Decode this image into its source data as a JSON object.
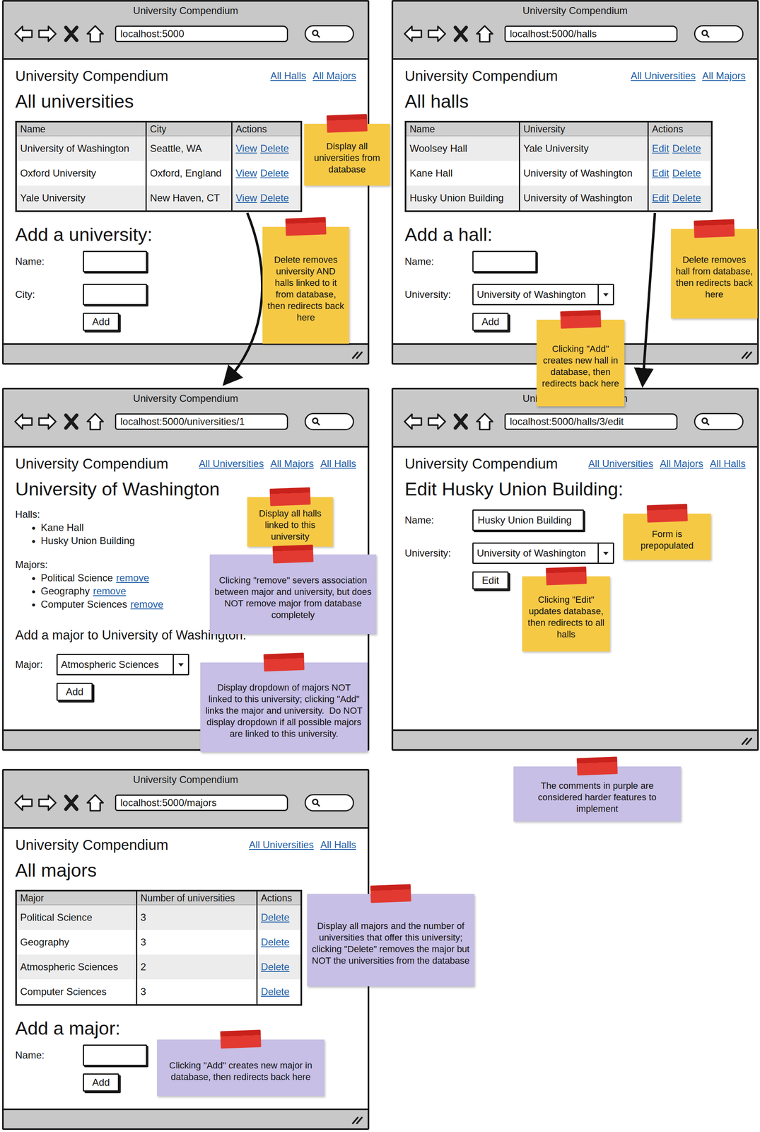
{
  "windows": [
    {
      "kind": "list",
      "title": "University Compendium",
      "url": "localhost:5000",
      "brand": "University Compendium",
      "nav": [
        "All Halls",
        "All Majors"
      ],
      "heading": "All universities",
      "table": {
        "columns": [
          "Name",
          "City",
          "Actions"
        ],
        "rows": [
          {
            "cells": [
              "University of Washington",
              "Seattle, WA"
            ],
            "actions": [
              "View",
              "Delete"
            ]
          },
          {
            "cells": [
              "Oxford University",
              "Oxford, England"
            ],
            "actions": [
              "View",
              "Delete"
            ]
          },
          {
            "cells": [
              "Yale University",
              "New Haven, CT"
            ],
            "actions": [
              "View",
              "Delete"
            ]
          }
        ]
      },
      "form": {
        "title": "Add a university:",
        "fields": [
          {
            "label": "Name:",
            "kind": "text",
            "value": ""
          },
          {
            "label": "City:",
            "kind": "text",
            "value": ""
          }
        ],
        "button": "Add"
      }
    },
    {
      "kind": "list",
      "title": "University Compendium",
      "url": "localhost:5000/halls",
      "brand": "University Compendium",
      "nav": [
        "All Universities",
        "All Majors"
      ],
      "heading": "All halls",
      "table": {
        "columns": [
          "Name",
          "University",
          "Actions"
        ],
        "rows": [
          {
            "cells": [
              "Woolsey Hall",
              "Yale University"
            ],
            "actions": [
              "Edit",
              "Delete"
            ]
          },
          {
            "cells": [
              "Kane Hall",
              "University of Washington"
            ],
            "actions": [
              "Edit",
              "Delete"
            ]
          },
          {
            "cells": [
              "Husky Union Building",
              "University of Washington"
            ],
            "actions": [
              "Edit",
              "Delete"
            ]
          }
        ]
      },
      "form": {
        "title": "Add a hall:",
        "fields": [
          {
            "label": "Name:",
            "kind": "text",
            "value": ""
          },
          {
            "label": "University:",
            "kind": "select",
            "value": "University of Washington"
          }
        ],
        "button": "Add"
      }
    },
    {
      "kind": "detail",
      "title": "University Compendium",
      "url": "localhost:5000/universities/1",
      "brand": "University Compendium",
      "nav": [
        "All Universities",
        "All Majors",
        "All Halls"
      ],
      "heading": "University of Washington",
      "sections": [
        {
          "title": "Halls:",
          "items": [
            {
              "text": "Kane Hall"
            },
            {
              "text": "Husky Union Building"
            }
          ]
        },
        {
          "title": "Majors:",
          "items": [
            {
              "text": "Political Science",
              "action": "remove"
            },
            {
              "text": "Geography",
              "action": "remove"
            },
            {
              "text": "Computer Sciences",
              "action": "remove"
            }
          ]
        }
      ],
      "form": {
        "title": "Add a major to University of Washington:",
        "fields": [
          {
            "label": "Major:",
            "kind": "select",
            "value": "Atmospheric Sciences"
          }
        ],
        "button": "Add"
      }
    },
    {
      "kind": "edit",
      "title": "University Compendium",
      "url": "localhost:5000/halls/3/edit",
      "brand": "University Compendium",
      "nav": [
        "All Universities",
        "All Majors",
        "All Halls"
      ],
      "heading": "Edit Husky Union Building:",
      "form": {
        "fields": [
          {
            "label": "Name:",
            "kind": "text",
            "value": "Husky Union Building"
          },
          {
            "label": "University:",
            "kind": "select",
            "value": "University of Washington"
          }
        ],
        "button": "Edit"
      }
    },
    {
      "kind": "list",
      "title": "University Compendium",
      "url": "localhost:5000/majors",
      "brand": "University Compendium",
      "nav": [
        "All Universities",
        "All Halls"
      ],
      "heading": "All majors",
      "table": {
        "columns": [
          "Major",
          "Number of universities",
          "Actions"
        ],
        "rows": [
          {
            "cells": [
              "Political Science",
              "3"
            ],
            "actions": [
              "Delete"
            ]
          },
          {
            "cells": [
              "Geography",
              "3"
            ],
            "actions": [
              "Delete"
            ]
          },
          {
            "cells": [
              "Atmospheric Sciences",
              "2"
            ],
            "actions": [
              "Delete"
            ]
          },
          {
            "cells": [
              "Computer Sciences",
              "3"
            ],
            "actions": [
              "Delete"
            ]
          }
        ]
      },
      "form": {
        "title": "Add a major:",
        "fields": [
          {
            "label": "Name:",
            "kind": "text",
            "value": ""
          }
        ],
        "button": "Add"
      }
    }
  ],
  "notes": [
    {
      "text": "Display all universities from database",
      "color": "#f6c945"
    },
    {
      "text": "Delete removes university AND halls linked to it from database, then redirects back here",
      "color": "#f6c945"
    },
    {
      "text": "Delete removes hall from database, then redirects back here",
      "color": "#f6c945"
    },
    {
      "text": "Clicking \"Add\" creates new hall in database, then redirects back here",
      "color": "#f6c945"
    },
    {
      "text": "Display all halls linked to this university",
      "color": "#f6c945"
    },
    {
      "text": "Clicking \"remove\" severs association between major and university, but does NOT remove major from database completely",
      "color": "#c7bfe5"
    },
    {
      "text": "Display dropdown of majors NOT linked to this university; clicking \"Add\" links the major and university.  Do NOT display dropdown if all possible majors are linked to this university.",
      "color": "#c7bfe5"
    },
    {
      "text": "Form is prepopulated",
      "color": "#f6c945"
    },
    {
      "text": "Clicking \"Edit\" updates database, then redirects to all halls",
      "color": "#f6c945"
    },
    {
      "text": "The comments in purple are considered harder features to implement",
      "color": "#c7bfe5"
    },
    {
      "text": "Display all majors and the number of universities that offer this university; clicking \"Delete\" removes the major but NOT the universities from the database",
      "color": "#c7bfe5"
    },
    {
      "text": "Clicking \"Add\" creates new major in database, then redirects back here",
      "color": "#c7bfe5"
    }
  ]
}
